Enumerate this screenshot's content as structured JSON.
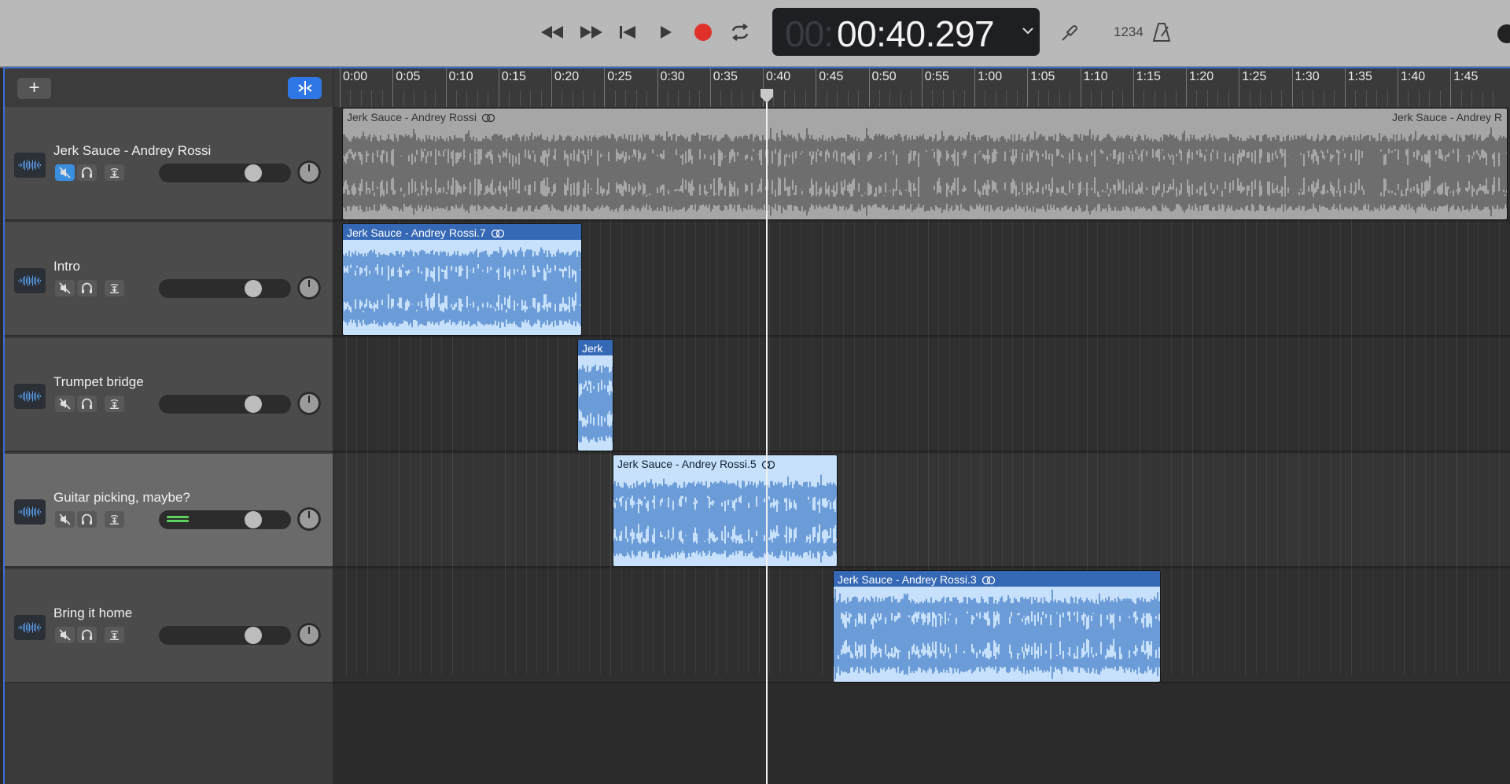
{
  "transport": {
    "time_dim": "00:",
    "time": "00:40.297",
    "bar_count_label": "1234",
    "buttons": [
      "rewind",
      "fast-forward",
      "go-to-beginning",
      "play",
      "record",
      "cycle"
    ]
  },
  "ruler": {
    "ticks": [
      "0:00",
      "0:05",
      "0:10",
      "0:15",
      "0:20",
      "0:25",
      "0:30",
      "0:35",
      "0:40",
      "0:45",
      "0:50",
      "0:55",
      "1:00",
      "1:05",
      "1:10",
      "1:15",
      "1:20",
      "1:25",
      "1:30",
      "1:35",
      "1:40",
      "1:45"
    ]
  },
  "header": {
    "add_label": "+"
  },
  "tracks": [
    {
      "name": "Jerk Sauce - Andrey Rossi",
      "mute_active": true,
      "selected": false,
      "meter": false
    },
    {
      "name": "Intro",
      "mute_active": false,
      "selected": false,
      "meter": false
    },
    {
      "name": "Trumpet bridge",
      "mute_active": false,
      "selected": false,
      "meter": false
    },
    {
      "name": "Guitar picking, maybe?",
      "mute_active": false,
      "selected": true,
      "meter": true
    },
    {
      "name": "Bring it home",
      "mute_active": false,
      "selected": false,
      "meter": false
    }
  ],
  "regions": [
    {
      "track": 0,
      "title": "Jerk Sauce - Andrey Rossi",
      "title_right": "Jerk Sauce - Andrey R",
      "style": "grey",
      "loop": true
    },
    {
      "track": 1,
      "title": "Jerk Sauce - Andrey Rossi.7",
      "style": "blue",
      "loop": true
    },
    {
      "track": 2,
      "title": "Jerk",
      "style": "blue",
      "loop": false
    },
    {
      "track": 3,
      "title": "Jerk Sauce - Andrey Rossi.5",
      "style": "blue-light",
      "loop": true
    },
    {
      "track": 4,
      "title": "Jerk Sauce - Andrey Rossi.3",
      "style": "blue",
      "loop": true
    }
  ],
  "colors": {
    "accent": "#2f77e6",
    "record": "#e0302a",
    "region_blue": "#3568b5",
    "region_light": "#c7e0fb",
    "meter_green": "#5cd15c"
  }
}
